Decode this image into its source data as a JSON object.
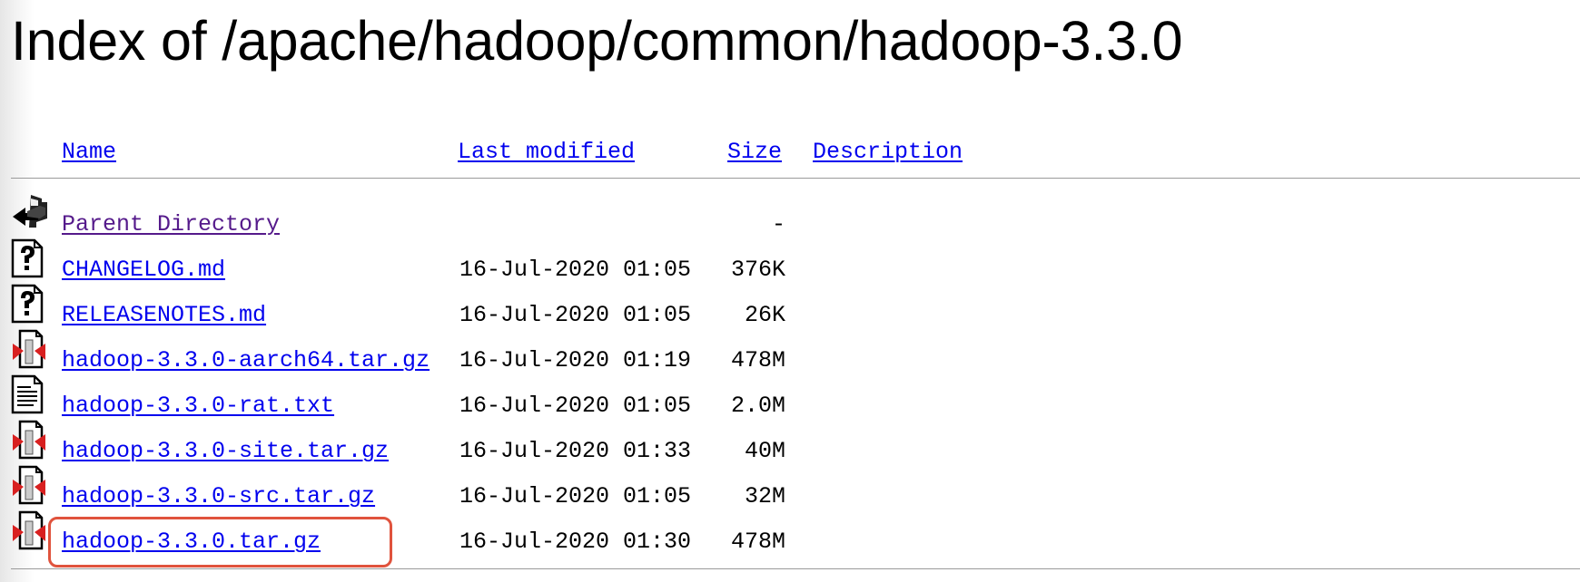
{
  "page": {
    "title": "Index of /apache/hadoop/common/hadoop-3.3.0"
  },
  "columns": {
    "name": "Name",
    "last_modified": "Last modified",
    "size": "Size",
    "description": "Description"
  },
  "rows": [
    {
      "icon": "back-arrow-icon",
      "name": "Parent Directory",
      "date": "",
      "size": "-"
    },
    {
      "icon": "unknown-file-icon",
      "name": "CHANGELOG.md",
      "date": "16-Jul-2020 01:05",
      "size": "376K"
    },
    {
      "icon": "unknown-file-icon",
      "name": "RELEASENOTES.md",
      "date": "16-Jul-2020 01:05",
      "size": "26K"
    },
    {
      "icon": "compressed-file-icon",
      "name": "hadoop-3.3.0-aarch64.tar.gz",
      "date": "16-Jul-2020 01:19",
      "size": "478M"
    },
    {
      "icon": "text-file-icon",
      "name": "hadoop-3.3.0-rat.txt",
      "date": "16-Jul-2020 01:05",
      "size": "2.0M"
    },
    {
      "icon": "compressed-file-icon",
      "name": "hadoop-3.3.0-site.tar.gz",
      "date": "16-Jul-2020 01:33",
      "size": "40M"
    },
    {
      "icon": "compressed-file-icon",
      "name": "hadoop-3.3.0-src.tar.gz",
      "date": "16-Jul-2020 01:05",
      "size": "32M"
    },
    {
      "icon": "compressed-file-icon",
      "name": "hadoop-3.3.0.tar.gz",
      "date": "16-Jul-2020 01:30",
      "size": "478M"
    }
  ],
  "colors": {
    "link": "#0000ee",
    "visited_link": "#551a8b",
    "highlight_box": "#e0533d",
    "rule": "#9a9a9a"
  }
}
